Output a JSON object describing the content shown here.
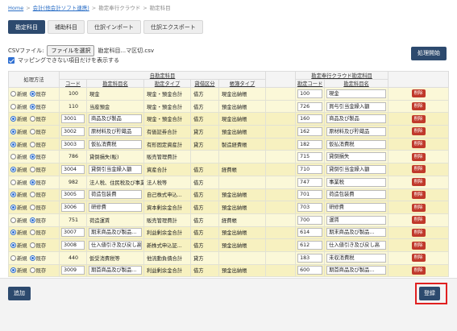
{
  "breadcrumb": {
    "home": "Home",
    "accounting": "会計(他会計ソフト連携)",
    "workflow": "勘定奉行クラウド",
    "current": "勘定科目"
  },
  "tabs": [
    "勘定科目",
    "補助科目",
    "仕訳インポート",
    "仕訳エクスポート"
  ],
  "csv": {
    "label": "CSVファイル:",
    "button": "ファイルを選択",
    "filename": "勘定科目...マ区切.csv"
  },
  "show_unmapped": "マッピングできない項目だけを表示する",
  "run_button": "処理開始",
  "table": {
    "headers": {
      "process": "処理方法",
      "own_group": "自勘定科目",
      "code": "コード",
      "name": "勘定科目名",
      "account_type": "勘定タイプ",
      "debit_credit": "貸借区分",
      "ledger_type": "帳簿タイプ",
      "target_group": "勘定奉行クラウド勘定科目",
      "target_code": "勘定コード",
      "target_name": "勘定科目名"
    },
    "radio_new": "新規",
    "radio_existing": "既存",
    "delete": "削除",
    "rows": [
      {
        "choice": "existing",
        "code": "100",
        "name": "現金",
        "atype": "現金・預金合計",
        "dc": "借方",
        "ltype": "現金出納帳",
        "tcode": "100",
        "tname": "現金",
        "editable": false
      },
      {
        "choice": "existing",
        "code": "110",
        "name": "当座預金",
        "atype": "現金・預金合計",
        "dc": "借方",
        "ltype": "預金出納帳",
        "tcode": "726",
        "tname": "買与引当金繰入額",
        "editable": false
      },
      {
        "choice": "new",
        "code": "3001",
        "name": "商品及び製品",
        "atype": "現金・預金合計",
        "dc": "借方",
        "ltype": "現金出納帳",
        "tcode": "160",
        "tname": "商品及び製品",
        "editable": true
      },
      {
        "choice": "new",
        "code": "3002",
        "name": "原材料及び貯蔵品",
        "atype": "有価証券合計",
        "dc": "貸方",
        "ltype": "預金出納帳",
        "tcode": "162",
        "tname": "原材料及び貯蔵品",
        "editable": true
      },
      {
        "choice": "new",
        "code": "3003",
        "name": "仮払消費税",
        "atype": "有形固定資産計",
        "dc": "貸方",
        "ltype": "製造経費帳",
        "tcode": "182",
        "tname": "仮払消費税",
        "editable": true
      },
      {
        "choice": "existing",
        "code": "786",
        "name": "貸倒損失(販)",
        "atype": "販売管理費計",
        "dc": "",
        "ltype": "",
        "tcode": "715",
        "tname": "貸倒損失",
        "editable": false
      },
      {
        "choice": "new",
        "code": "3004",
        "name": "貸倒引当金繰入額",
        "atype": "資産合計",
        "dc": "借方",
        "ltype": "経費帳",
        "tcode": "710",
        "tname": "貸倒引当金繰入額",
        "editable": true
      },
      {
        "choice": "existing",
        "code": "982",
        "name": "法人税、住民税及び事業税",
        "atype": "法人税等",
        "dc": "借方",
        "ltype": "",
        "tcode": "747",
        "tname": "事業税",
        "editable": false
      },
      {
        "choice": "new",
        "code": "3005",
        "name": "荷造包装費",
        "atype": "自己株式申込...",
        "dc": "借方",
        "ltype": "預金出納帳",
        "tcode": "701",
        "tname": "荷造包装費",
        "editable": true
      },
      {
        "choice": "new",
        "code": "3006",
        "name": "研修費",
        "atype": "資本剰余金合計",
        "dc": "借方",
        "ltype": "預金出納帳",
        "tcode": "703",
        "tname": "研修費",
        "editable": true
      },
      {
        "choice": "existing",
        "code": "751",
        "name": "荷造運賃",
        "atype": "販売管理費計",
        "dc": "借方",
        "ltype": "経費帳",
        "tcode": "700",
        "tname": "運賃",
        "editable": false
      },
      {
        "choice": "new",
        "code": "3007",
        "name": "期末商品及び製品...",
        "atype": "利益剰余金合計",
        "dc": "借方",
        "ltype": "預金出納帳",
        "tcode": "614",
        "tname": "期末商品及び製品...",
        "editable": true
      },
      {
        "choice": "new",
        "code": "3008",
        "name": "仕入値引き及び戻し高",
        "atype": "新株式申込証...",
        "dc": "借方",
        "ltype": "預金出納帳",
        "tcode": "612",
        "tname": "仕入値引き及び戻し高",
        "editable": true
      },
      {
        "choice": "existing",
        "code": "440",
        "name": "仮受消費税等",
        "atype": "他流動負債合計",
        "dc": "貸方",
        "ltype": "",
        "tcode": "183",
        "tname": "未収消費税",
        "editable": false
      },
      {
        "choice": "new",
        "code": "3009",
        "name": "期首商品及び製品...",
        "atype": "利益剰余金合計",
        "dc": "借方",
        "ltype": "預金出納帳",
        "tcode": "600",
        "tname": "期首商品及び製品...",
        "editable": true
      }
    ]
  },
  "add_button": "追加",
  "register_button": "登録",
  "colors": {
    "primary": "#2d4a6e",
    "danger": "#c0392b",
    "row_bg": "#fbf8d8",
    "highlight": "#e02020"
  }
}
